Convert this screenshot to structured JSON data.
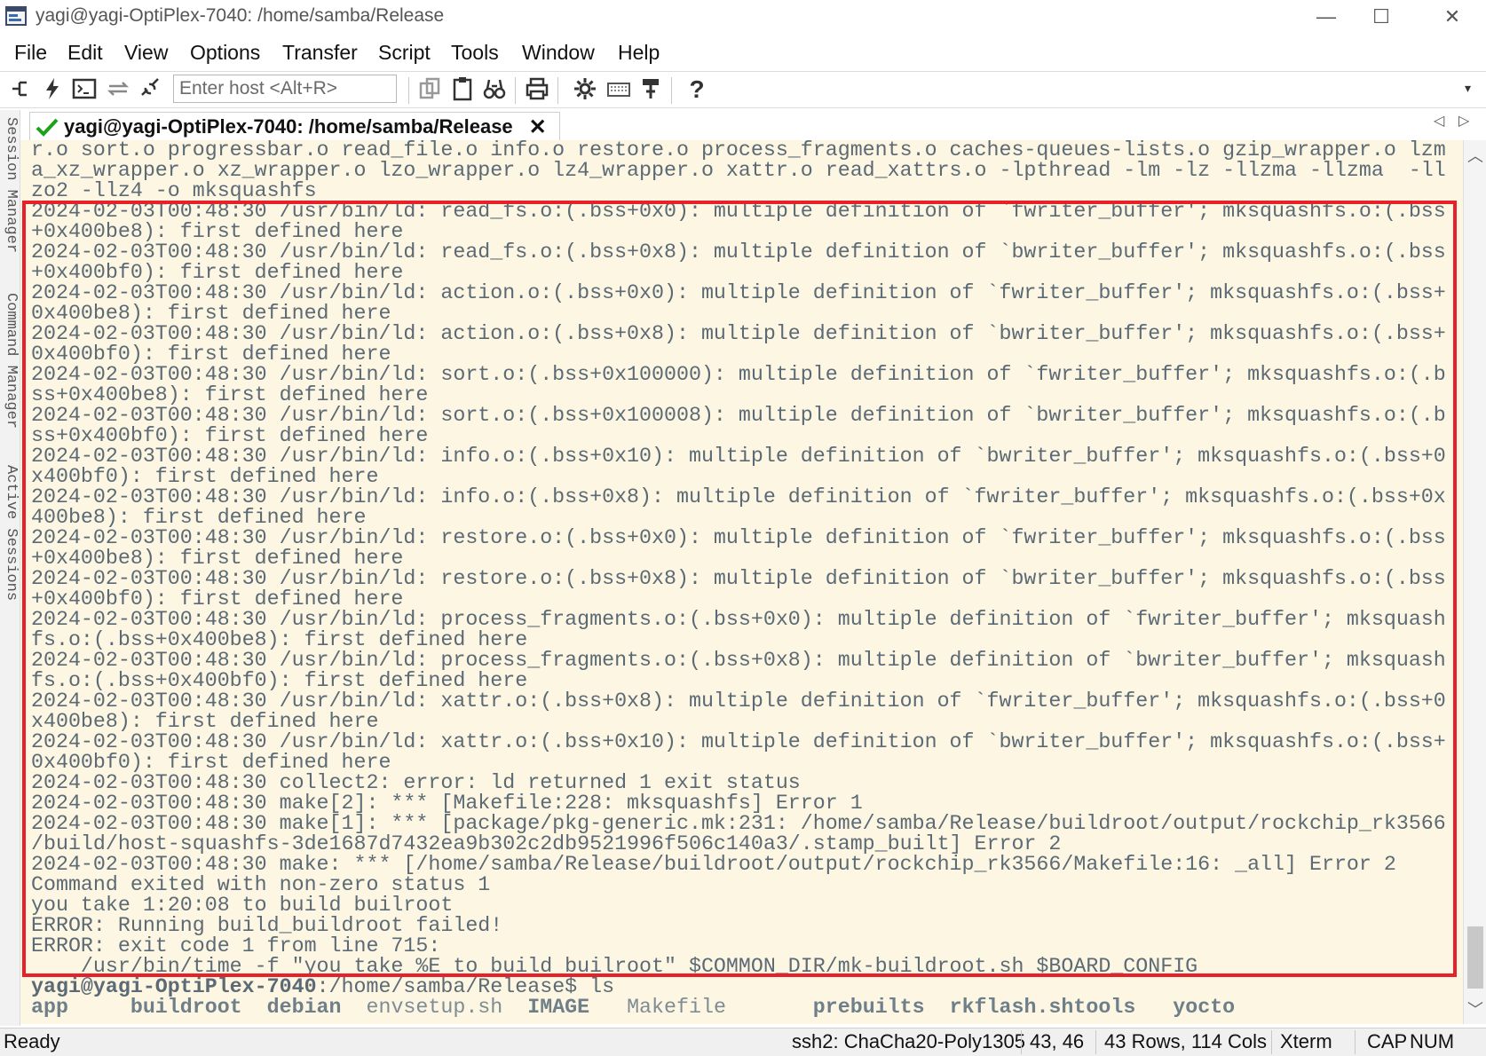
{
  "window": {
    "title": "yagi@yagi-OptiPlex-7040: /home/samba/Release",
    "minimize": "—",
    "maximize": "☐",
    "close": "✕"
  },
  "menu": {
    "items": [
      "File",
      "Edit",
      "View",
      "Options",
      "Transfer",
      "Script",
      "Tools",
      "Window",
      "Help"
    ]
  },
  "toolbar": {
    "host_placeholder": "Enter host <Alt+R>",
    "help_label": "?",
    "overflow_label": "▾"
  },
  "sidebar": {
    "panels": [
      "Session Manager",
      "Command Manager",
      "Active Sessions"
    ]
  },
  "session_tab": {
    "label": "yagi@yagi-OptiPlex-7040: /home/samba/Release",
    "close": "✕",
    "nav_left": "◁",
    "nav_right": "▷"
  },
  "terminal": {
    "lines": [
      "r.o sort.o progressbar.o read_file.o info.o restore.o process_fragments.o caches-queues-lists.o gzip_wrapper.o lzm",
      "a_xz_wrapper.o xz_wrapper.o lzo_wrapper.o lz4_wrapper.o xattr.o read_xattrs.o -lpthread -lm -lz -llzma -llzma  -ll",
      "zo2 -llz4 -o mksquashfs",
      "2024-02-03T00:48:30 /usr/bin/ld: read_fs.o:(.bss+0x0): multiple definition of `fwriter_buffer'; mksquashfs.o:(.bss",
      "+0x400be8): first defined here",
      "2024-02-03T00:48:30 /usr/bin/ld: read_fs.o:(.bss+0x8): multiple definition of `bwriter_buffer'; mksquashfs.o:(.bss",
      "+0x400bf0): first defined here",
      "2024-02-03T00:48:30 /usr/bin/ld: action.o:(.bss+0x0): multiple definition of `fwriter_buffer'; mksquashfs.o:(.bss+",
      "0x400be8): first defined here",
      "2024-02-03T00:48:30 /usr/bin/ld: action.o:(.bss+0x8): multiple definition of `bwriter_buffer'; mksquashfs.o:(.bss+",
      "0x400bf0): first defined here",
      "2024-02-03T00:48:30 /usr/bin/ld: sort.o:(.bss+0x100000): multiple definition of `fwriter_buffer'; mksquashfs.o:(.b",
      "ss+0x400be8): first defined here",
      "2024-02-03T00:48:30 /usr/bin/ld: sort.o:(.bss+0x100008): multiple definition of `bwriter_buffer'; mksquashfs.o:(.b",
      "ss+0x400bf0): first defined here",
      "2024-02-03T00:48:30 /usr/bin/ld: info.o:(.bss+0x10): multiple definition of `bwriter_buffer'; mksquashfs.o:(.bss+0",
      "x400bf0): first defined here",
      "2024-02-03T00:48:30 /usr/bin/ld: info.o:(.bss+0x8): multiple definition of `fwriter_buffer'; mksquashfs.o:(.bss+0x",
      "400be8): first defined here",
      "2024-02-03T00:48:30 /usr/bin/ld: restore.o:(.bss+0x0): multiple definition of `fwriter_buffer'; mksquashfs.o:(.bss",
      "+0x400be8): first defined here",
      "2024-02-03T00:48:30 /usr/bin/ld: restore.o:(.bss+0x8): multiple definition of `bwriter_buffer'; mksquashfs.o:(.bss",
      "+0x400bf0): first defined here",
      "2024-02-03T00:48:30 /usr/bin/ld: process_fragments.o:(.bss+0x0): multiple definition of `fwriter_buffer'; mksquash",
      "fs.o:(.bss+0x400be8): first defined here",
      "2024-02-03T00:48:30 /usr/bin/ld: process_fragments.o:(.bss+0x8): multiple definition of `bwriter_buffer'; mksquash",
      "fs.o:(.bss+0x400bf0): first defined here",
      "2024-02-03T00:48:30 /usr/bin/ld: xattr.o:(.bss+0x8): multiple definition of `fwriter_buffer'; mksquashfs.o:(.bss+0",
      "x400be8): first defined here",
      "2024-02-03T00:48:30 /usr/bin/ld: xattr.o:(.bss+0x10): multiple definition of `bwriter_buffer'; mksquashfs.o:(.bss+",
      "0x400bf0): first defined here",
      "2024-02-03T00:48:30 collect2: error: ld returned 1 exit status",
      "2024-02-03T00:48:30 make[2]: *** [Makefile:228: mksquashfs] Error 1",
      "2024-02-03T00:48:30 make[1]: *** [package/pkg-generic.mk:231: /home/samba/Release/buildroot/output/rockchip_rk3566",
      "/build/host-squashfs-3de1687d7432ea9b302c2db9521996f506c140a3/.stamp_built] Error 2",
      "2024-02-03T00:48:30 make: *** [/home/samba/Release/buildroot/output/rockchip_rk3566/Makefile:16: _all] Error 2",
      "Command exited with non-zero status 1",
      "you take 1:20:08 to build builroot",
      "ERROR: Running build_buildroot failed!",
      "ERROR: exit code 1 from line 715:",
      "    /usr/bin/time -f \"you take %E to build builroot\" $COMMON_DIR/mk-buildroot.sh $BOARD_CONFIG"
    ],
    "prompt": {
      "user_host": "yagi@yagi-OptiPlex-7040",
      "path": ":/home/samba/Release$ ls"
    },
    "ls_output": [
      {
        "name": "app",
        "type": "dir"
      },
      {
        "name": "buildroot",
        "type": "dir"
      },
      {
        "name": "debian",
        "type": "dir"
      },
      {
        "name": "envsetup.sh",
        "type": "file"
      },
      {
        "name": "IMAGE",
        "type": "dir"
      },
      {
        "name": "Makefile",
        "type": "file"
      },
      {
        "name": "prebuilts",
        "type": "dir"
      },
      {
        "name": "rkflash.sh",
        "type": "dir"
      },
      {
        "name": "tools",
        "type": "dir"
      },
      {
        "name": "yocto",
        "type": "dir"
      }
    ],
    "highlight_color": "#e8202a"
  },
  "statusbar": {
    "ready": "Ready",
    "cipher": "ssh2: ChaCha20-Poly1305",
    "cursor": "43,  46",
    "size": "43 Rows, 114 Cols",
    "term": "Xterm",
    "caps": "CAP",
    "num": "NUM"
  }
}
